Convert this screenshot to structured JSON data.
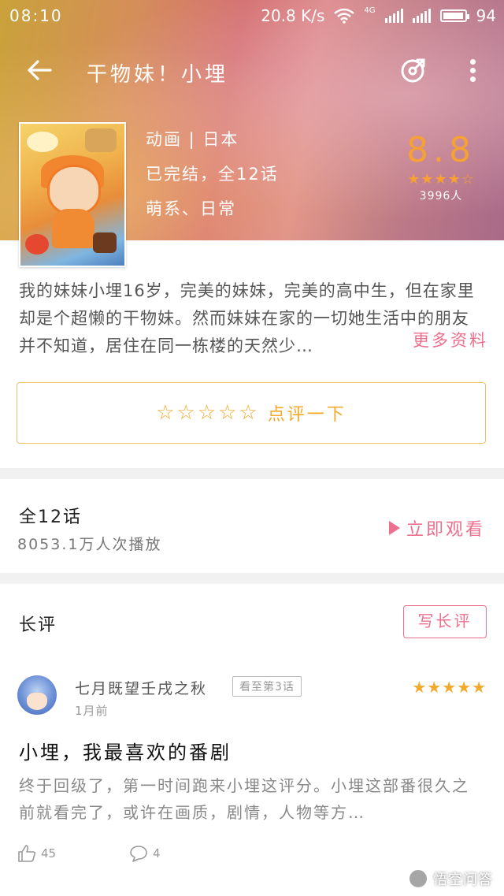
{
  "status_bar": {
    "time": "08:10",
    "speed": "20.8 K/s",
    "network": "4G",
    "battery": "94"
  },
  "nav": {
    "title": "干物妹！小埋"
  },
  "anime": {
    "meta_line1": "动画 | 日本",
    "meta_line2": "已完结，全12话",
    "meta_line3": "萌系、日常",
    "score": "8.8",
    "score_stars": "★★★★☆",
    "rating_count": "3996人",
    "description": "我的妹妹小埋16岁，完美的妹妹，完美的高中生，但在家里却是个超懒的干物妹。然而妹妹在家的一切她生活中的朋友并不知道，居住在同一栋楼的天然少…",
    "more_link": "更多资料"
  },
  "rate_prompt": {
    "stars": "☆☆☆☆☆",
    "label": "点评一下"
  },
  "episodes": {
    "title": "全12话",
    "plays": "8053.1万人次播放",
    "watch_label": "立即观看"
  },
  "long_review": {
    "section_title": "长评",
    "write_button": "写长评",
    "review": {
      "user": "七月既望壬戌之秋",
      "progress": "看至第3话",
      "time": "1月前",
      "stars": "★★★★★",
      "title": "小埋，我最喜欢的番剧",
      "body": "终于回级了，第一时间跑来小埋这评分。小埋这部番很久之前就看完了，或许在画质，剧情，人物等方…",
      "likes": "45",
      "comments": "4"
    }
  },
  "watermark": "悟空问答",
  "colors": {
    "accent_pink": "#ec6f8e",
    "star_orange": "#f3a92a",
    "score_orange": "#f7a033"
  }
}
